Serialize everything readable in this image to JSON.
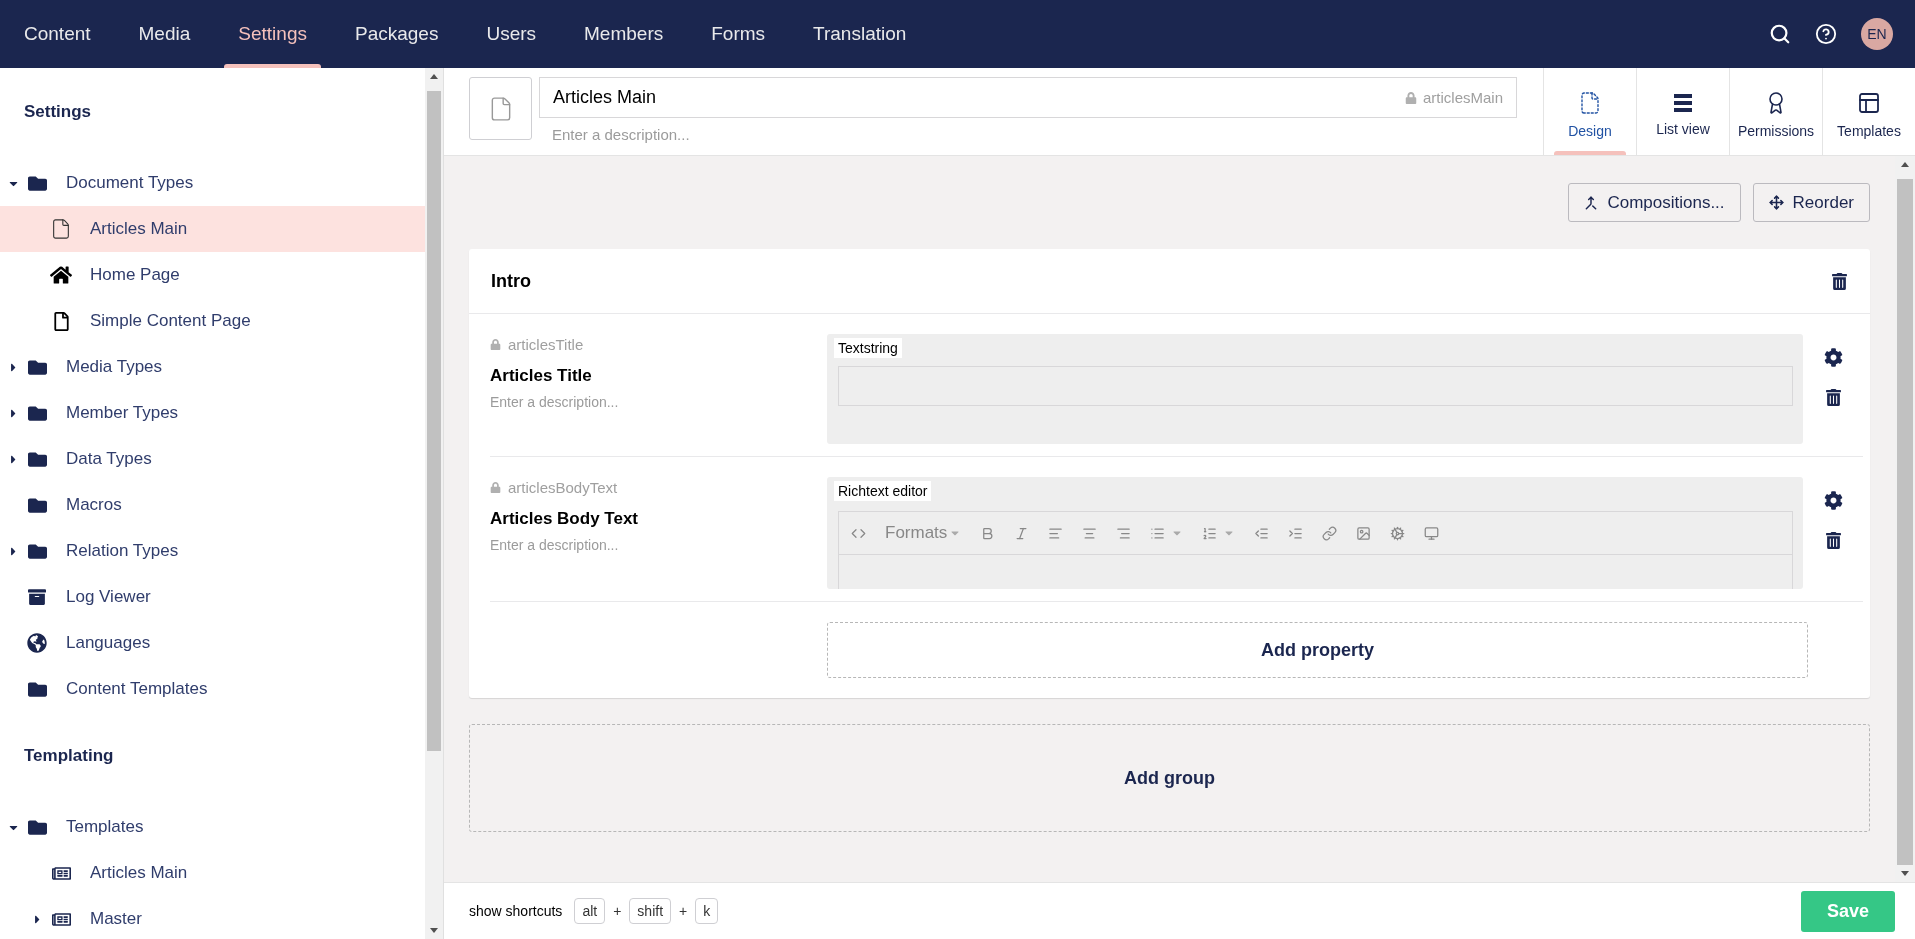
{
  "top_nav": {
    "tabs": [
      {
        "label": "Content",
        "selected": false
      },
      {
        "label": "Media",
        "selected": false
      },
      {
        "label": "Settings",
        "selected": true
      },
      {
        "label": "Packages",
        "selected": false
      },
      {
        "label": "Users",
        "selected": false
      },
      {
        "label": "Members",
        "selected": false
      },
      {
        "label": "Forms",
        "selected": false
      },
      {
        "label": "Translation",
        "selected": false
      }
    ],
    "avatar": "EN"
  },
  "sidebar": {
    "sections": [
      {
        "title": "Settings",
        "items": [
          {
            "label": "Document Types",
            "kind": "folder",
            "selected": false,
            "expanded": true,
            "children": [
              {
                "label": "Articles Main",
                "kind": "document",
                "selected": true
              },
              {
                "label": "Home Page",
                "kind": "home",
                "selected": false
              },
              {
                "label": "Simple Content Page",
                "kind": "page",
                "selected": false
              }
            ]
          },
          {
            "label": "Media Types",
            "kind": "folder",
            "selected": false,
            "expanded": false
          },
          {
            "label": "Member Types",
            "kind": "folder",
            "selected": false,
            "expanded": false
          },
          {
            "label": "Data Types",
            "kind": "folder",
            "selected": false,
            "expanded": false
          },
          {
            "label": "Macros",
            "kind": "folder",
            "selected": false
          },
          {
            "label": "Relation Types",
            "kind": "folder",
            "selected": false,
            "expanded": false
          },
          {
            "label": "Log Viewer",
            "kind": "archive",
            "selected": false
          },
          {
            "label": "Languages",
            "kind": "globe",
            "selected": false
          },
          {
            "label": "Content Templates",
            "kind": "folder",
            "selected": false
          }
        ]
      },
      {
        "title": "Templating",
        "items": [
          {
            "label": "Templates",
            "kind": "folder",
            "selected": false,
            "expanded": true,
            "children": [
              {
                "label": "Articles Main",
                "kind": "template",
                "selected": false
              },
              {
                "label": "Master",
                "kind": "template",
                "selected": false,
                "expanded": false
              }
            ]
          }
        ]
      }
    ]
  },
  "editor_header": {
    "name": "Articles Main",
    "alias": "articlesMain",
    "description_placeholder": "Enter a description...",
    "views": [
      {
        "label": "Design",
        "kind": "design",
        "selected": true
      },
      {
        "label": "List view",
        "kind": "list",
        "selected": false
      },
      {
        "label": "Permissions",
        "kind": "permissions",
        "selected": false
      },
      {
        "label": "Templates",
        "kind": "templates",
        "selected": false
      }
    ]
  },
  "actions": [
    {
      "label": "Compositions...",
      "kind": "compositions"
    },
    {
      "label": "Reorder",
      "kind": "reorder"
    }
  ],
  "group": {
    "title": "Intro",
    "properties": [
      {
        "alias": "articlesTitle",
        "name": "Articles Title",
        "description_placeholder": "Enter a description...",
        "editor": "Textstring",
        "kind": "textstring"
      },
      {
        "alias": "articlesBodyText",
        "name": "Articles Body Text",
        "description_placeholder": "Enter a description...",
        "editor": "Richtext editor",
        "kind": "richtext",
        "formats_label": "Formats"
      }
    ],
    "add_property": "Add property"
  },
  "add_group": "Add group",
  "footer": {
    "shortcuts_label": "show shortcuts",
    "shortcut": [
      {
        "kind": "key",
        "label": "alt"
      },
      {
        "kind": "plus",
        "label": "+"
      },
      {
        "kind": "key",
        "label": "shift"
      },
      {
        "kind": "plus",
        "label": "+"
      },
      {
        "kind": "key",
        "label": "k"
      }
    ],
    "save": "Save"
  }
}
